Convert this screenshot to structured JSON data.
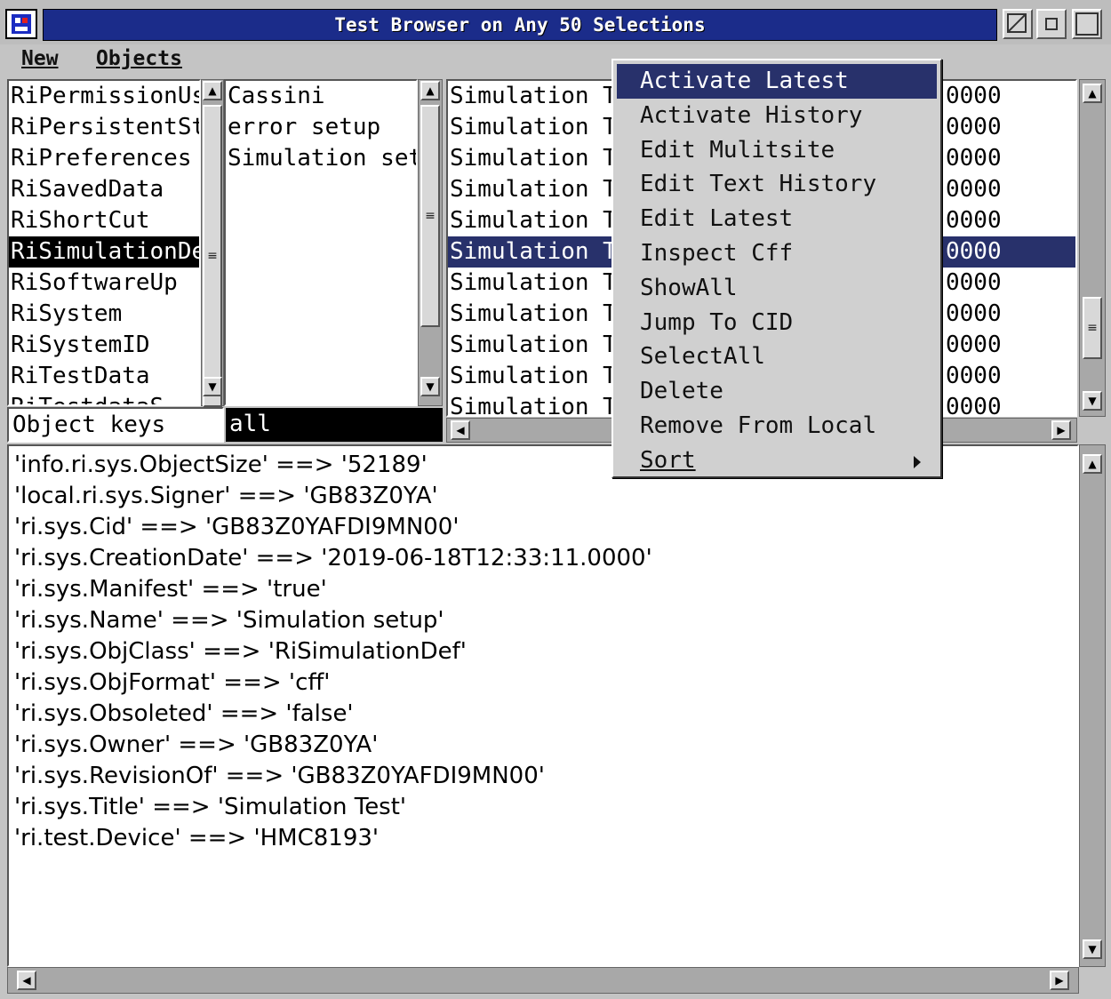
{
  "window": {
    "title": "Test Browser on  Any 50 Selections"
  },
  "menubar": {
    "new_label": "New",
    "objects_label": "Objects"
  },
  "classes": {
    "items": [
      "RiPermissionUs",
      "RiPersistentSt",
      "RiPreferences",
      "RiSavedData",
      "RiShortCut",
      "RiSimulationDe",
      "RiSoftwareUp",
      "RiSystem",
      "RiSystemID",
      "RiTestData",
      "RiTestdataS"
    ],
    "selected_index": 5
  },
  "groups": {
    "items": [
      "Cassini",
      "error setup",
      "Simulation set"
    ]
  },
  "objects": {
    "items": [
      {
        "left": "Simulation T",
        "right": "0000"
      },
      {
        "left": "Simulation T",
        "right": "0000"
      },
      {
        "left": "Simulation T",
        "right": "0000"
      },
      {
        "left": "Simulation T",
        "right": "0000"
      },
      {
        "left": "Simulation T",
        "right": "0000"
      },
      {
        "left": "Simulation T",
        "right": "0000"
      },
      {
        "left": "Simulation T",
        "right": "0000"
      },
      {
        "left": "Simulation T",
        "right": "0000"
      },
      {
        "left": "Simulation T",
        "right": "0000"
      },
      {
        "left": "Simulation T",
        "right": "0000"
      },
      {
        "left": "Simulation T",
        "right": "0000"
      }
    ],
    "selected_index": 5
  },
  "filter": {
    "label": "Object keys",
    "value": "all"
  },
  "details": {
    "lines": [
      "'info.ri.sys.ObjectSize' ==> '52189'",
      "'local.ri.sys.Signer' ==> 'GB83Z0YA'",
      "'ri.sys.Cid' ==> 'GB83Z0YAFDI9MN00'",
      "'ri.sys.CreationDate' ==> '2019-06-18T12:33:11.0000'",
      "'ri.sys.Manifest' ==> 'true'",
      "'ri.sys.Name' ==> 'Simulation setup'",
      "'ri.sys.ObjClass' ==> 'RiSimulationDef'",
      "'ri.sys.ObjFormat' ==> 'cff'",
      "'ri.sys.Obsoleted' ==> 'false'",
      "'ri.sys.Owner' ==> 'GB83Z0YA'",
      "'ri.sys.RevisionOf' ==> 'GB83Z0YAFDI9MN00'",
      "'ri.sys.Title' ==> 'Simulation Test'",
      "'ri.test.Device' ==> 'HMC8193'"
    ]
  },
  "context_menu": {
    "items": [
      "Activate Latest",
      "Activate History",
      "Edit Mulitsite",
      "Edit Text History",
      "Edit Latest",
      "Inspect Cff",
      "ShowAll",
      "Jump To CID",
      "SelectAll",
      "Delete",
      "Remove From Local",
      "Sort"
    ],
    "active_index": 0
  },
  "colors": {
    "title_bar": "#1b2c8a",
    "selection": "#28316b",
    "chrome": "#c4c4c4"
  }
}
